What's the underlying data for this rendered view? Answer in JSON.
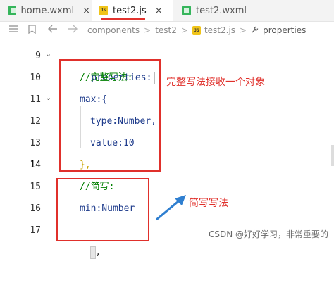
{
  "tabs": [
    {
      "label": "home.wxml",
      "type": "wxml",
      "active": false
    },
    {
      "label": "test2.js",
      "type": "js",
      "active": true
    },
    {
      "label": "test2.wxml",
      "type": "wxml",
      "active": false
    }
  ],
  "tab_close_glyph": "×",
  "js_icon_text": "JS",
  "breadcrumb": {
    "items": [
      "components",
      "test2",
      "test2.js",
      "properties"
    ],
    "separator": ">"
  },
  "code_lines": [
    {
      "num": "9",
      "text": "properties:"
    },
    {
      "num": "10",
      "text": "//完整写法:"
    },
    {
      "num": "11",
      "text": "max:{"
    },
    {
      "num": "12",
      "text": "type:Number,"
    },
    {
      "num": "13",
      "text": "value:10"
    },
    {
      "num": "14",
      "text": "},"
    },
    {
      "num": "15",
      "text": "//简写:"
    },
    {
      "num": "16",
      "text": "min:Number"
    },
    {
      "num": "17",
      "text": ","
    }
  ],
  "annotations": {
    "full_form": "完整写法接收一个对象",
    "short_form": "简写写法"
  },
  "watermark": "CSDN @好好学习，非常重要的",
  "colors": {
    "highlight_red": "#e0302b",
    "comment_green": "#008000",
    "number_green": "#098658",
    "property_blue": "#1f3c8c",
    "arrow_blue": "#2f7fd0"
  }
}
